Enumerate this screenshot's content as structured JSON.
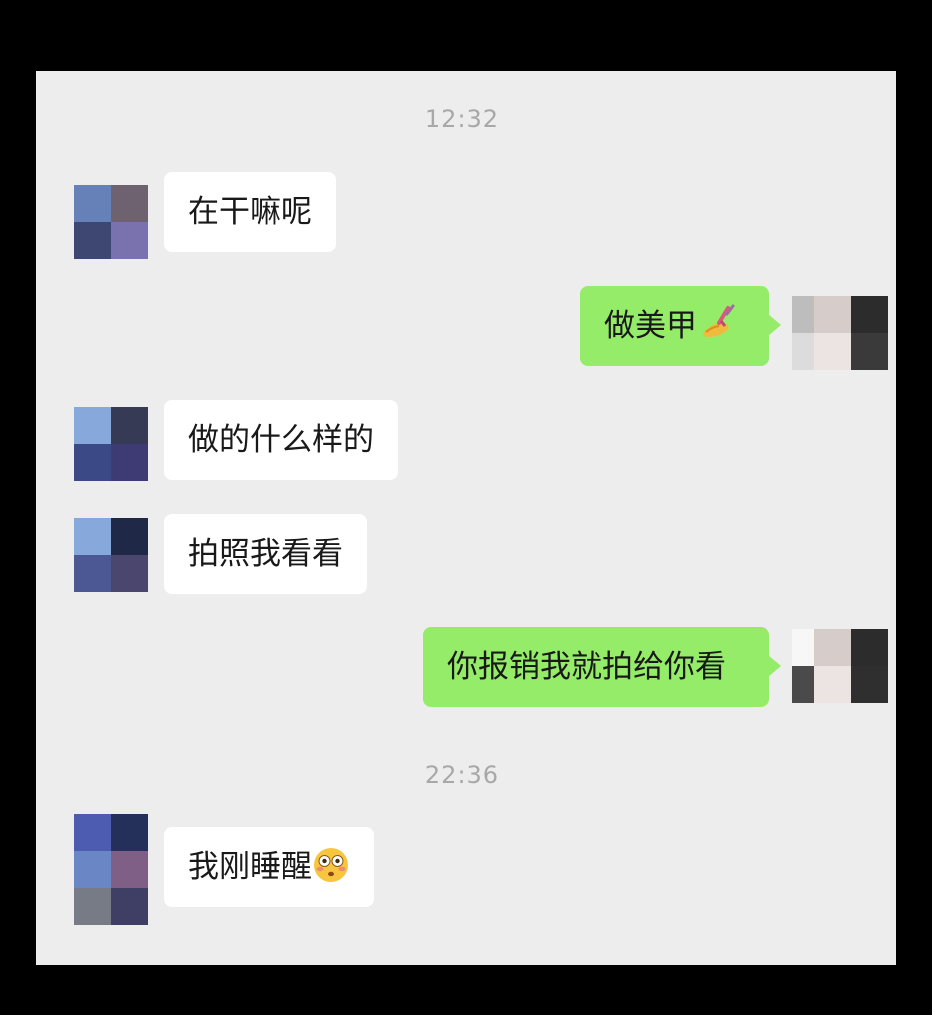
{
  "chat": {
    "time_1": "12:32",
    "time_2": "22:36",
    "messages": [
      {
        "side": "received",
        "text": "在干嘛呢"
      },
      {
        "side": "sent",
        "text": "做美甲",
        "emoji": "nail-polish-icon"
      },
      {
        "side": "received",
        "text": "做的什么样的"
      },
      {
        "side": "received",
        "text": "拍照我看看"
      },
      {
        "side": "sent",
        "text": "你报销我就拍给你看"
      },
      {
        "side": "received",
        "text": "我刚睡醒",
        "emoji": "flushed-face-icon"
      }
    ]
  },
  "colors": {
    "background": "#ededed",
    "sent_bubble": "#95ec69",
    "received_bubble": "#ffffff",
    "timestamp": "#a8a8a8"
  }
}
